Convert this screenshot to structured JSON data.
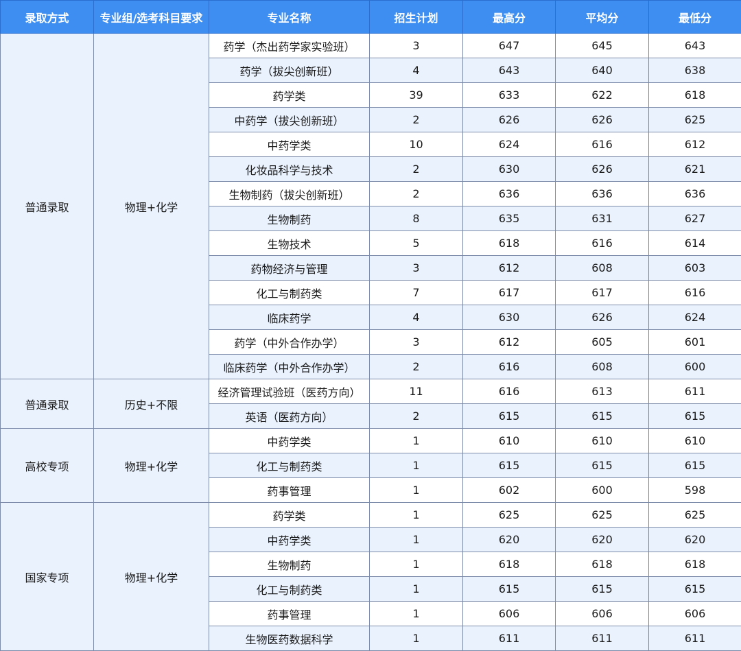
{
  "headers": [
    "录取方式",
    "专业组/选考科目要求",
    "专业名称",
    "招生计划",
    "最高分",
    "平均分",
    "最低分"
  ],
  "groups": [
    {
      "method": "普通录取",
      "subjects": "物理+化学",
      "rows": [
        {
          "major": "药学（杰出药学家实验班）",
          "plan": "3",
          "max": "647",
          "avg": "645",
          "min": "643"
        },
        {
          "major": "药学（拔尖创新班）",
          "plan": "4",
          "max": "643",
          "avg": "640",
          "min": "638"
        },
        {
          "major": "药学类",
          "plan": "39",
          "max": "633",
          "avg": "622",
          "min": "618"
        },
        {
          "major": "中药学（拔尖创新班）",
          "plan": "2",
          "max": "626",
          "avg": "626",
          "min": "625"
        },
        {
          "major": "中药学类",
          "plan": "10",
          "max": "624",
          "avg": "616",
          "min": "612"
        },
        {
          "major": "化妆品科学与技术",
          "plan": "2",
          "max": "630",
          "avg": "626",
          "min": "621"
        },
        {
          "major": "生物制药（拔尖创新班）",
          "plan": "2",
          "max": "636",
          "avg": "636",
          "min": "636"
        },
        {
          "major": "生物制药",
          "plan": "8",
          "max": "635",
          "avg": "631",
          "min": "627"
        },
        {
          "major": "生物技术",
          "plan": "5",
          "max": "618",
          "avg": "616",
          "min": "614"
        },
        {
          "major": "药物经济与管理",
          "plan": "3",
          "max": "612",
          "avg": "608",
          "min": "603"
        },
        {
          "major": "化工与制药类",
          "plan": "7",
          "max": "617",
          "avg": "617",
          "min": "616"
        },
        {
          "major": "临床药学",
          "plan": "4",
          "max": "630",
          "avg": "626",
          "min": "624"
        },
        {
          "major": "药学（中外合作办学）",
          "plan": "3",
          "max": "612",
          "avg": "605",
          "min": "601"
        },
        {
          "major": "临床药学（中外合作办学）",
          "plan": "2",
          "max": "616",
          "avg": "608",
          "min": "600"
        }
      ]
    },
    {
      "method": "普通录取",
      "subjects": "历史+不限",
      "rows": [
        {
          "major": "经济管理试验班（医药方向）",
          "plan": "11",
          "max": "616",
          "avg": "613",
          "min": "611"
        },
        {
          "major": "英语（医药方向）",
          "plan": "2",
          "max": "615",
          "avg": "615",
          "min": "615"
        }
      ]
    },
    {
      "method": "高校专项",
      "subjects": "物理+化学",
      "rows": [
        {
          "major": "中药学类",
          "plan": "1",
          "max": "610",
          "avg": "610",
          "min": "610"
        },
        {
          "major": "化工与制药类",
          "plan": "1",
          "max": "615",
          "avg": "615",
          "min": "615"
        },
        {
          "major": "药事管理",
          "plan": "1",
          "max": "602",
          "avg": "600",
          "min": "598"
        }
      ]
    },
    {
      "method": "国家专项",
      "subjects": "物理+化学",
      "rows": [
        {
          "major": "药学类",
          "plan": "1",
          "max": "625",
          "avg": "625",
          "min": "625"
        },
        {
          "major": "中药学类",
          "plan": "1",
          "max": "620",
          "avg": "620",
          "min": "620"
        },
        {
          "major": "生物制药",
          "plan": "1",
          "max": "618",
          "avg": "618",
          "min": "618"
        },
        {
          "major": "化工与制药类",
          "plan": "1",
          "max": "615",
          "avg": "615",
          "min": "615"
        },
        {
          "major": "药事管理",
          "plan": "1",
          "max": "606",
          "avg": "606",
          "min": "606"
        },
        {
          "major": "生物医药数据科学",
          "plan": "1",
          "max": "611",
          "avg": "611",
          "min": "611"
        }
      ]
    }
  ],
  "colors": {
    "header_bg": "#3d8ef0",
    "header_text": "#ffffff",
    "row_alt_bg": "#eaf2fd",
    "row_bg": "#ffffff",
    "border": "#7a8aa8"
  }
}
